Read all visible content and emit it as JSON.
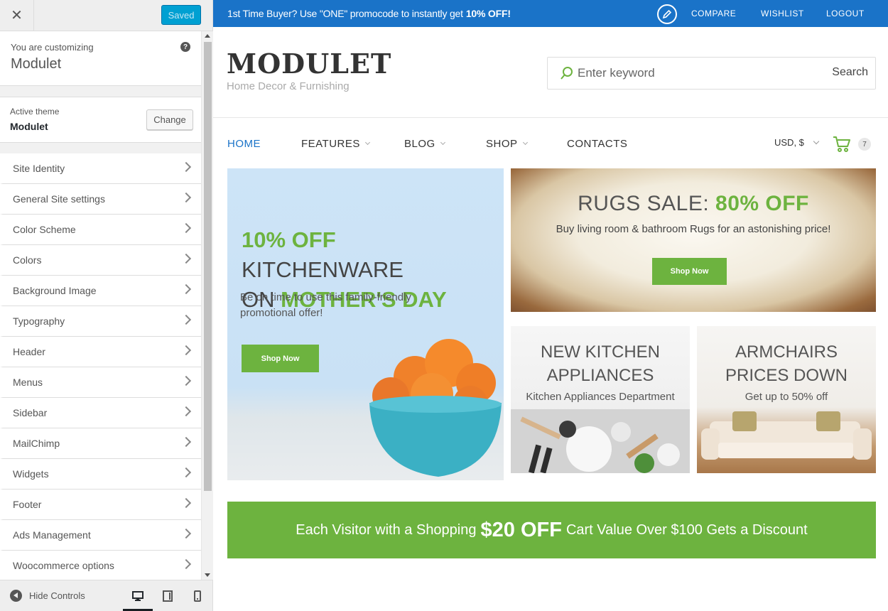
{
  "customizer": {
    "close_label": "✕",
    "saved_label": "Saved",
    "info": {
      "pre": "You are customizing",
      "title": "Modulet",
      "help": "?"
    },
    "theme": {
      "pre": "Active theme",
      "name": "Modulet",
      "change_label": "Change"
    },
    "menu": [
      "Site Identity",
      "General Site settings",
      "Color Scheme",
      "Colors",
      "Background Image",
      "Typography",
      "Header",
      "Menus",
      "Sidebar",
      "MailChimp",
      "Widgets",
      "Footer",
      "Ads Management",
      "Woocommerce options"
    ],
    "footer": {
      "hide_label": "Hide Controls",
      "devices": [
        "desktop-icon",
        "tablet-icon",
        "mobile-icon"
      ],
      "active_device": "desktop"
    }
  },
  "site": {
    "topbar": {
      "promo_text": "1st Time Buyer? Use \"ONE\" promocode to instantly get",
      "promo_bold": "10% OFF!",
      "links": [
        "COMPARE",
        "WISHLIST",
        "LOGOUT"
      ]
    },
    "header": {
      "logo": "MODULET",
      "tagline": "Home Decor & Furnishing",
      "search_placeholder": "Enter keyword",
      "search_button": "Search"
    },
    "nav": {
      "items": [
        "HOME",
        "FEATURES",
        "BLOG",
        "SHOP",
        "CONTACTS"
      ],
      "active": "HOME",
      "currency": "USD, $",
      "cart_count": "7"
    },
    "banners": {
      "main": {
        "line1_green": "10% OFF",
        "line1_rest": "KITCHENWARE",
        "line2_pre": "ON",
        "line2_green": "MOTHER'S DAY",
        "sub": "Be on time to use this family-friendly promotional offer!",
        "button": "Shop Now"
      },
      "rugs": {
        "title_pre": "RUGS SALE:",
        "title_green": "80% OFF",
        "sub": "Buy living room & bathroom Rugs for an astonishing price!",
        "button": "Shop Now"
      },
      "kitchen": {
        "title1": "NEW KITCHEN",
        "title2": "APPLIANCES",
        "sub": "Kitchen Appliances Department"
      },
      "armchairs": {
        "title1": "ARMCHAIRS",
        "title2": "PRICES DOWN",
        "sub": "Get up to 50% off"
      }
    },
    "promo_bar": {
      "pre": "Each Visitor with a Shopping",
      "big": "$20 OFF",
      "post": "Cart Value Over $100 Gets a Discount"
    },
    "colors": {
      "brand_blue": "#1a73c8",
      "accent_green": "#6db33f",
      "customizer_blue": "#00a0d2"
    }
  }
}
